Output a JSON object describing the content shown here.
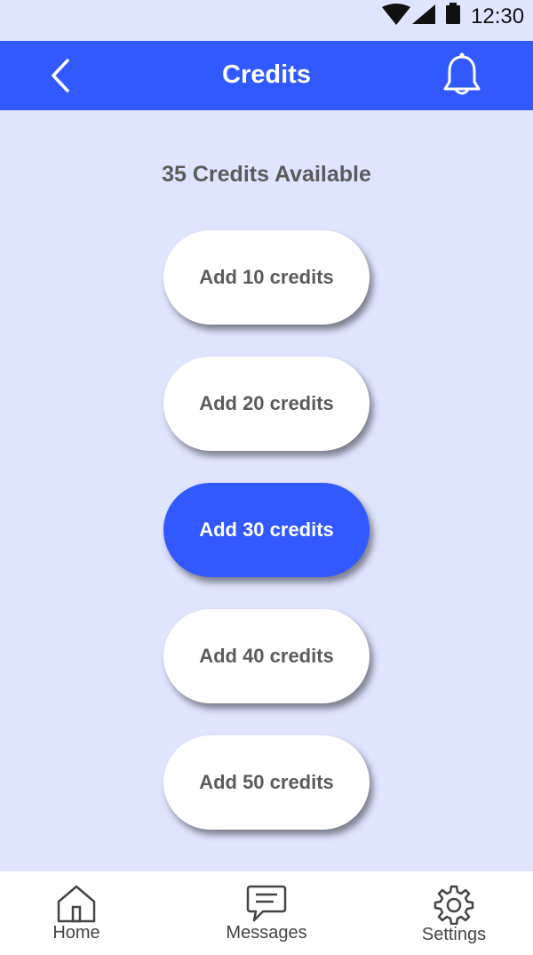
{
  "status_bar": {
    "time": "12:30",
    "icons": [
      "wifi-icon",
      "cell-signal-icon",
      "battery-icon"
    ]
  },
  "app_bar": {
    "title": "Credits",
    "back_icon": "chevron-left-icon",
    "notification_icon": "bell-icon",
    "background_color": "#3159ff"
  },
  "credits": {
    "summary": "35 Credits Available",
    "options": [
      {
        "label": "Add 10 credits",
        "selected": false
      },
      {
        "label": "Add 20 credits",
        "selected": false
      },
      {
        "label": "Add 30 credits",
        "selected": true
      },
      {
        "label": "Add 40 credits",
        "selected": false
      },
      {
        "label": "Add 50 credits",
        "selected": false
      }
    ]
  },
  "bottom_nav": {
    "items": [
      {
        "label": "Home",
        "icon": "home-icon"
      },
      {
        "label": "Messages",
        "icon": "message-icon"
      },
      {
        "label": "Settings",
        "icon": "gear-icon"
      }
    ]
  },
  "colors": {
    "accent": "#3159ff",
    "background": "#e0e5ff",
    "text": "#5b5b5b"
  }
}
